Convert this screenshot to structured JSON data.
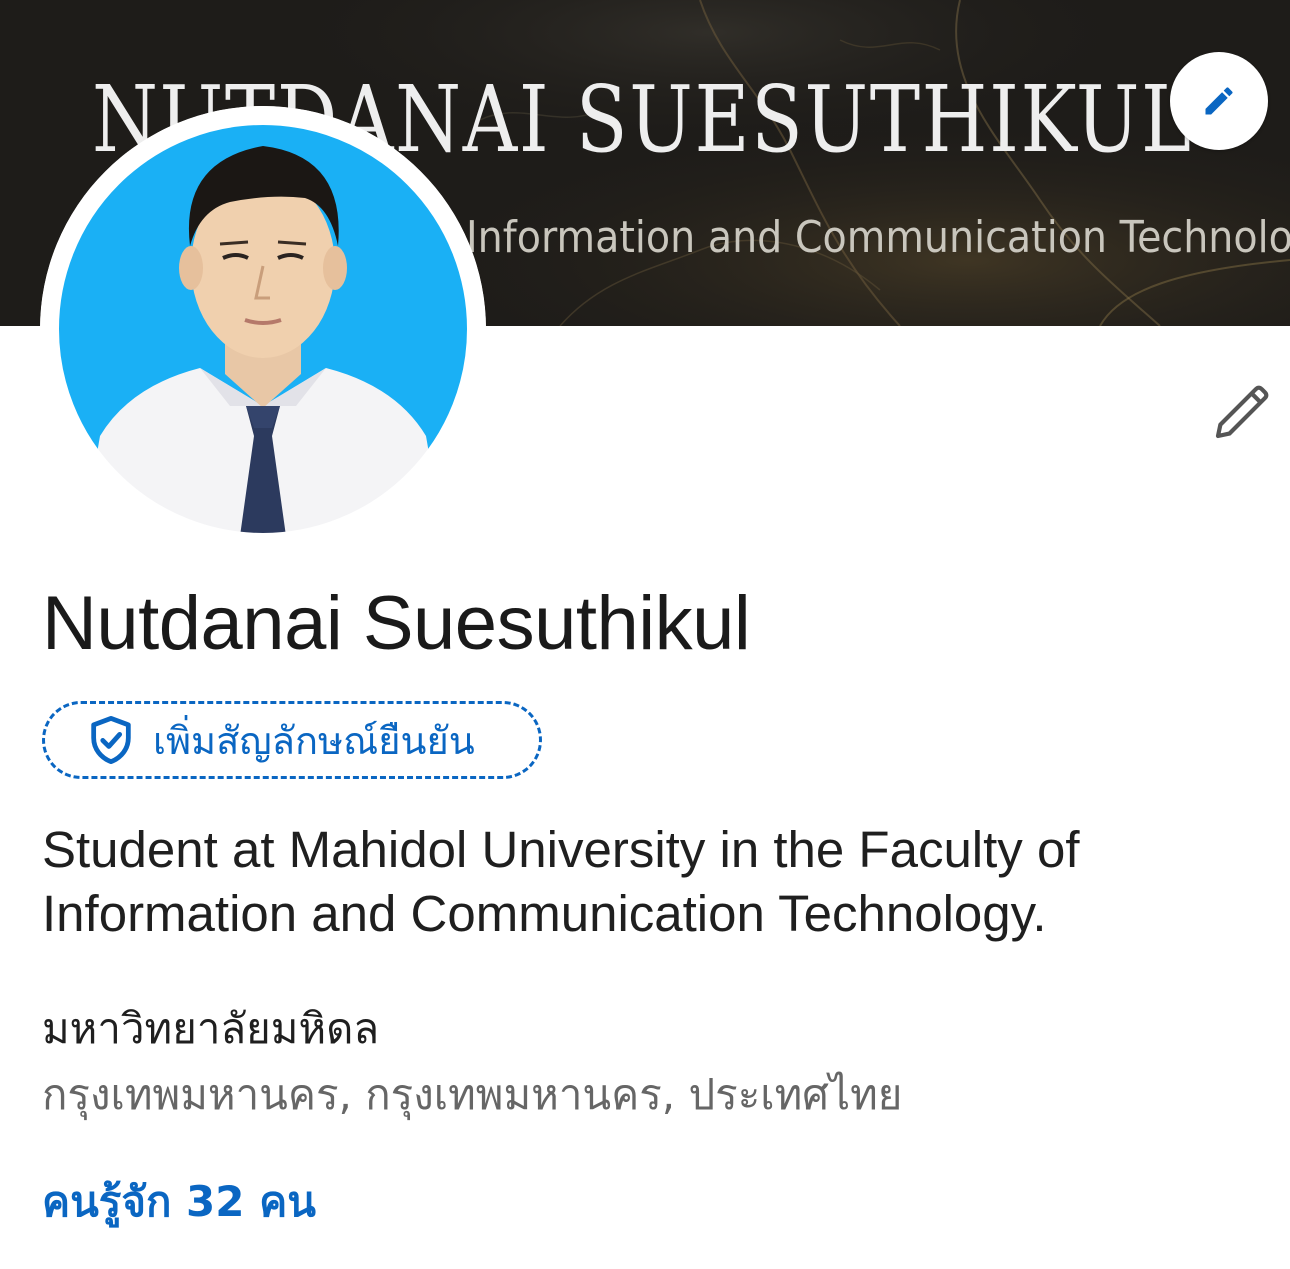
{
  "cover": {
    "title": "NUTDANAI  SUESUTHIKUL",
    "subtitle": "Information and Communication Technology"
  },
  "profile": {
    "name": "Nutdanai Suesuthikul",
    "verify_label": "เพิ่มสัญลักษณ์ยืนยัน",
    "headline": "Student at Mahidol University in the Faculty of Information and Communication Technology.",
    "school": "มหาวิทยาลัยมหิดล",
    "location": "กรุงเทพมหานคร, กรุงเทพมหานคร, ประเทศไทย",
    "connections": "คนรู้จัก 32 คน"
  },
  "icons": {
    "cover_edit": "pencil-icon",
    "intro_edit": "pencil-outline-icon",
    "verify": "shield-check-icon"
  },
  "colors": {
    "accent": "#0a66c2",
    "avatar_background": "#1ab0f5",
    "cover_background": "#1e1c19",
    "text_primary": "#1a1a1a",
    "text_secondary": "#666666"
  }
}
